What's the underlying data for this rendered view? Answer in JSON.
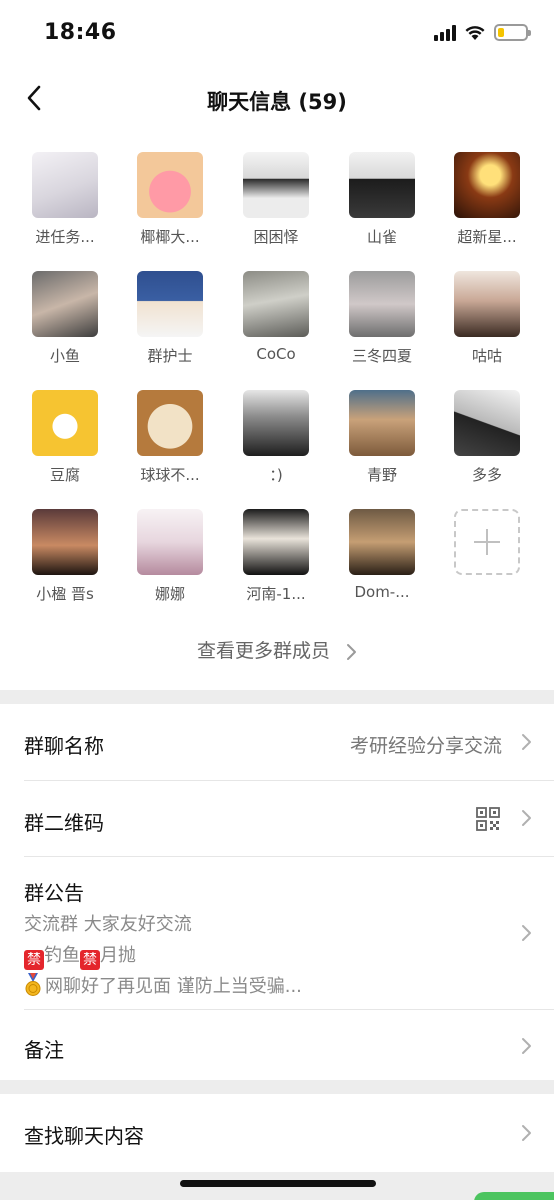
{
  "status_bar": {
    "time": "18:46",
    "battery_level": 0.22
  },
  "nav": {
    "title": "聊天信息 (59)"
  },
  "members": [
    {
      "name": "进任务..."
    },
    {
      "name": "椰椰大..."
    },
    {
      "name": "困困怿"
    },
    {
      "name": "山雀"
    },
    {
      "name": "超新星..."
    },
    {
      "name": "小鱼"
    },
    {
      "name": "群护士"
    },
    {
      "name": "CoCo"
    },
    {
      "name": "三冬四夏"
    },
    {
      "name": "咕咕"
    },
    {
      "name": "豆腐"
    },
    {
      "name": "球球不..."
    },
    {
      "name": "：)"
    },
    {
      "name": "青野"
    },
    {
      "name": "多多"
    },
    {
      "name": "小楹 晋s"
    },
    {
      "name": "娜娜"
    },
    {
      "name": "河南-1..."
    },
    {
      "name": "Dom-..."
    }
  ],
  "more_members_label": "查看更多群成员",
  "settings": {
    "group_name_label": "群聊名称",
    "group_name_value": "考研经验分享交流",
    "qr_label": "群二维码",
    "notice_label": "群公告",
    "notice_line1": "交流群 大家友好交流",
    "notice_ban_symbol": "禁",
    "notice_line2_a": "钓鱼",
    "notice_line2_b": "月抛",
    "notice_line3": "网聊好了再见面 谨防上当受骗...",
    "remark_label": "备注",
    "search_label": "查找聊天内容"
  }
}
